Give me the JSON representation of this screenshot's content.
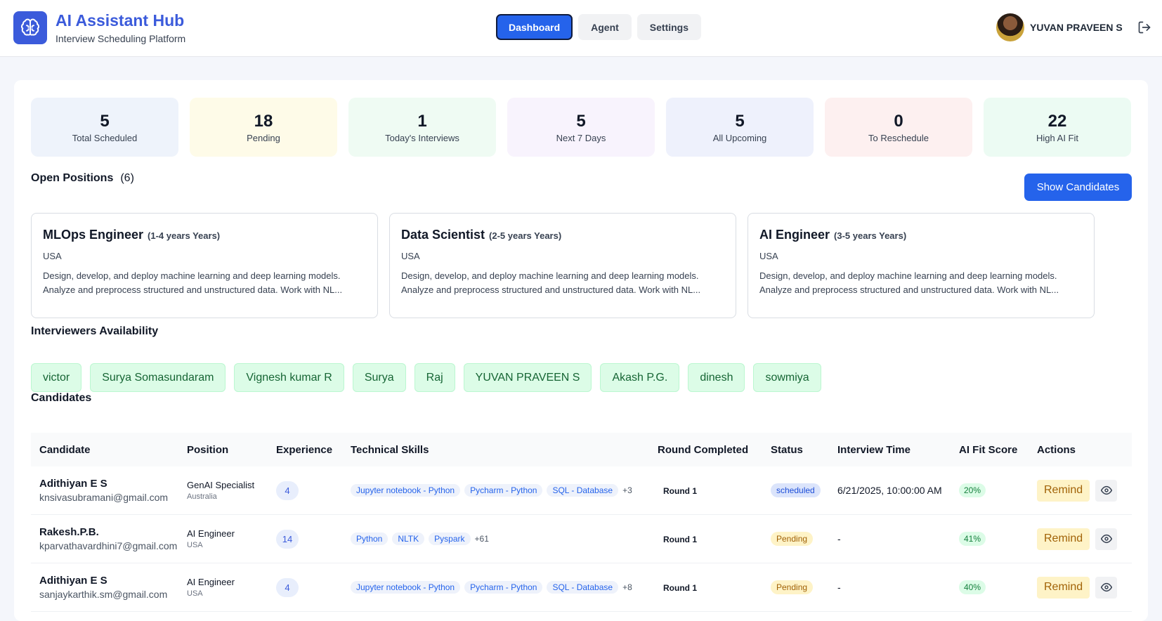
{
  "app": {
    "title": "AI Assistant Hub",
    "subtitle": "Interview Scheduling Platform",
    "logo_icon": "brain-icon",
    "accent_color": "#3b5bdb"
  },
  "nav": {
    "tabs": [
      {
        "label": "Dashboard",
        "active": true
      },
      {
        "label": "Agent",
        "active": false
      },
      {
        "label": "Settings",
        "active": false
      }
    ]
  },
  "user": {
    "name": "YUVAN PRAVEEN S",
    "logout_icon": "logout-icon"
  },
  "stats": [
    {
      "value": "5",
      "label": "Total Scheduled",
      "bg": "#eef3fb"
    },
    {
      "value": "18",
      "label": "Pending",
      "bg": "#fefbe8"
    },
    {
      "value": "1",
      "label": "Today's Interviews",
      "bg": "#effbf3"
    },
    {
      "value": "5",
      "label": "Next 7 Days",
      "bg": "#f8f3fd"
    },
    {
      "value": "5",
      "label": "All Upcoming",
      "bg": "#eef1fc"
    },
    {
      "value": "0",
      "label": "To Reschedule",
      "bg": "#fdf0f0"
    },
    {
      "value": "22",
      "label": "High AI Fit",
      "bg": "#ecfbf3"
    }
  ],
  "positions": {
    "title": "Open Positions",
    "count": "(6)",
    "show_button": "Show Candidates",
    "items": [
      {
        "title": "MLOps Engineer",
        "experience": "(1-4 years Years)",
        "location": "USA",
        "description": "Design, develop, and deploy machine learning and deep learning models. Analyze and preprocess structured and unstructured data. Work with NL..."
      },
      {
        "title": "Data Scientist",
        "experience": "(2-5 years Years)",
        "location": "USA",
        "description": "Design, develop, and deploy machine learning and deep learning models. Analyze and preprocess structured and unstructured data. Work with NL..."
      },
      {
        "title": "AI Engineer",
        "experience": "(3-5 years Years)",
        "location": "USA",
        "description": "Design, develop, and deploy machine learning and deep learning models. Analyze and preprocess structured and unstructured data. Work with NL..."
      }
    ]
  },
  "interviewers": {
    "title": "Interviewers Availability",
    "names": [
      "victor",
      "Surya Somasundaram",
      "Vignesh kumar R",
      "Surya",
      "Raj",
      "YUVAN PRAVEEN S",
      "Akash P.G.",
      "dinesh",
      "sowmiya"
    ]
  },
  "candidates": {
    "title": "Candidates",
    "columns": [
      "Candidate",
      "Position",
      "Experience",
      "Technical Skills",
      "Round Completed",
      "Status",
      "Interview Time",
      "AI Fit Score",
      "Actions"
    ],
    "remind_label": "Remind",
    "rows": [
      {
        "name": "Adithiyan E S",
        "email": "knsivasubramani@gmail.com",
        "position": "GenAI Specialist",
        "location": "Australia",
        "experience": "4",
        "skills": [
          "Jupyter notebook - Python",
          "Pycharm - Python",
          "SQL - Database"
        ],
        "more_skills": "+3",
        "round": "Round 1",
        "status": "scheduled",
        "time": "6/21/2025, 10:00:00 AM",
        "fit": "20%"
      },
      {
        "name": "Rakesh.P.B.",
        "email": "kparvathavardhini7@gmail.com",
        "position": "AI Engineer",
        "location": "USA",
        "experience": "14",
        "skills": [
          "Python",
          "NLTK",
          "Pyspark"
        ],
        "more_skills": "+61",
        "round": "Round 1",
        "status": "Pending",
        "time": "-",
        "fit": "41%"
      },
      {
        "name": "Adithiyan E S",
        "email": "sanjaykarthik.sm@gmail.com",
        "position": "AI Engineer",
        "location": "USA",
        "experience": "4",
        "skills": [
          "Jupyter notebook - Python",
          "Pycharm - Python",
          "SQL - Database"
        ],
        "more_skills": "+8",
        "round": "Round 1",
        "status": "Pending",
        "time": "-",
        "fit": "40%"
      }
    ]
  }
}
